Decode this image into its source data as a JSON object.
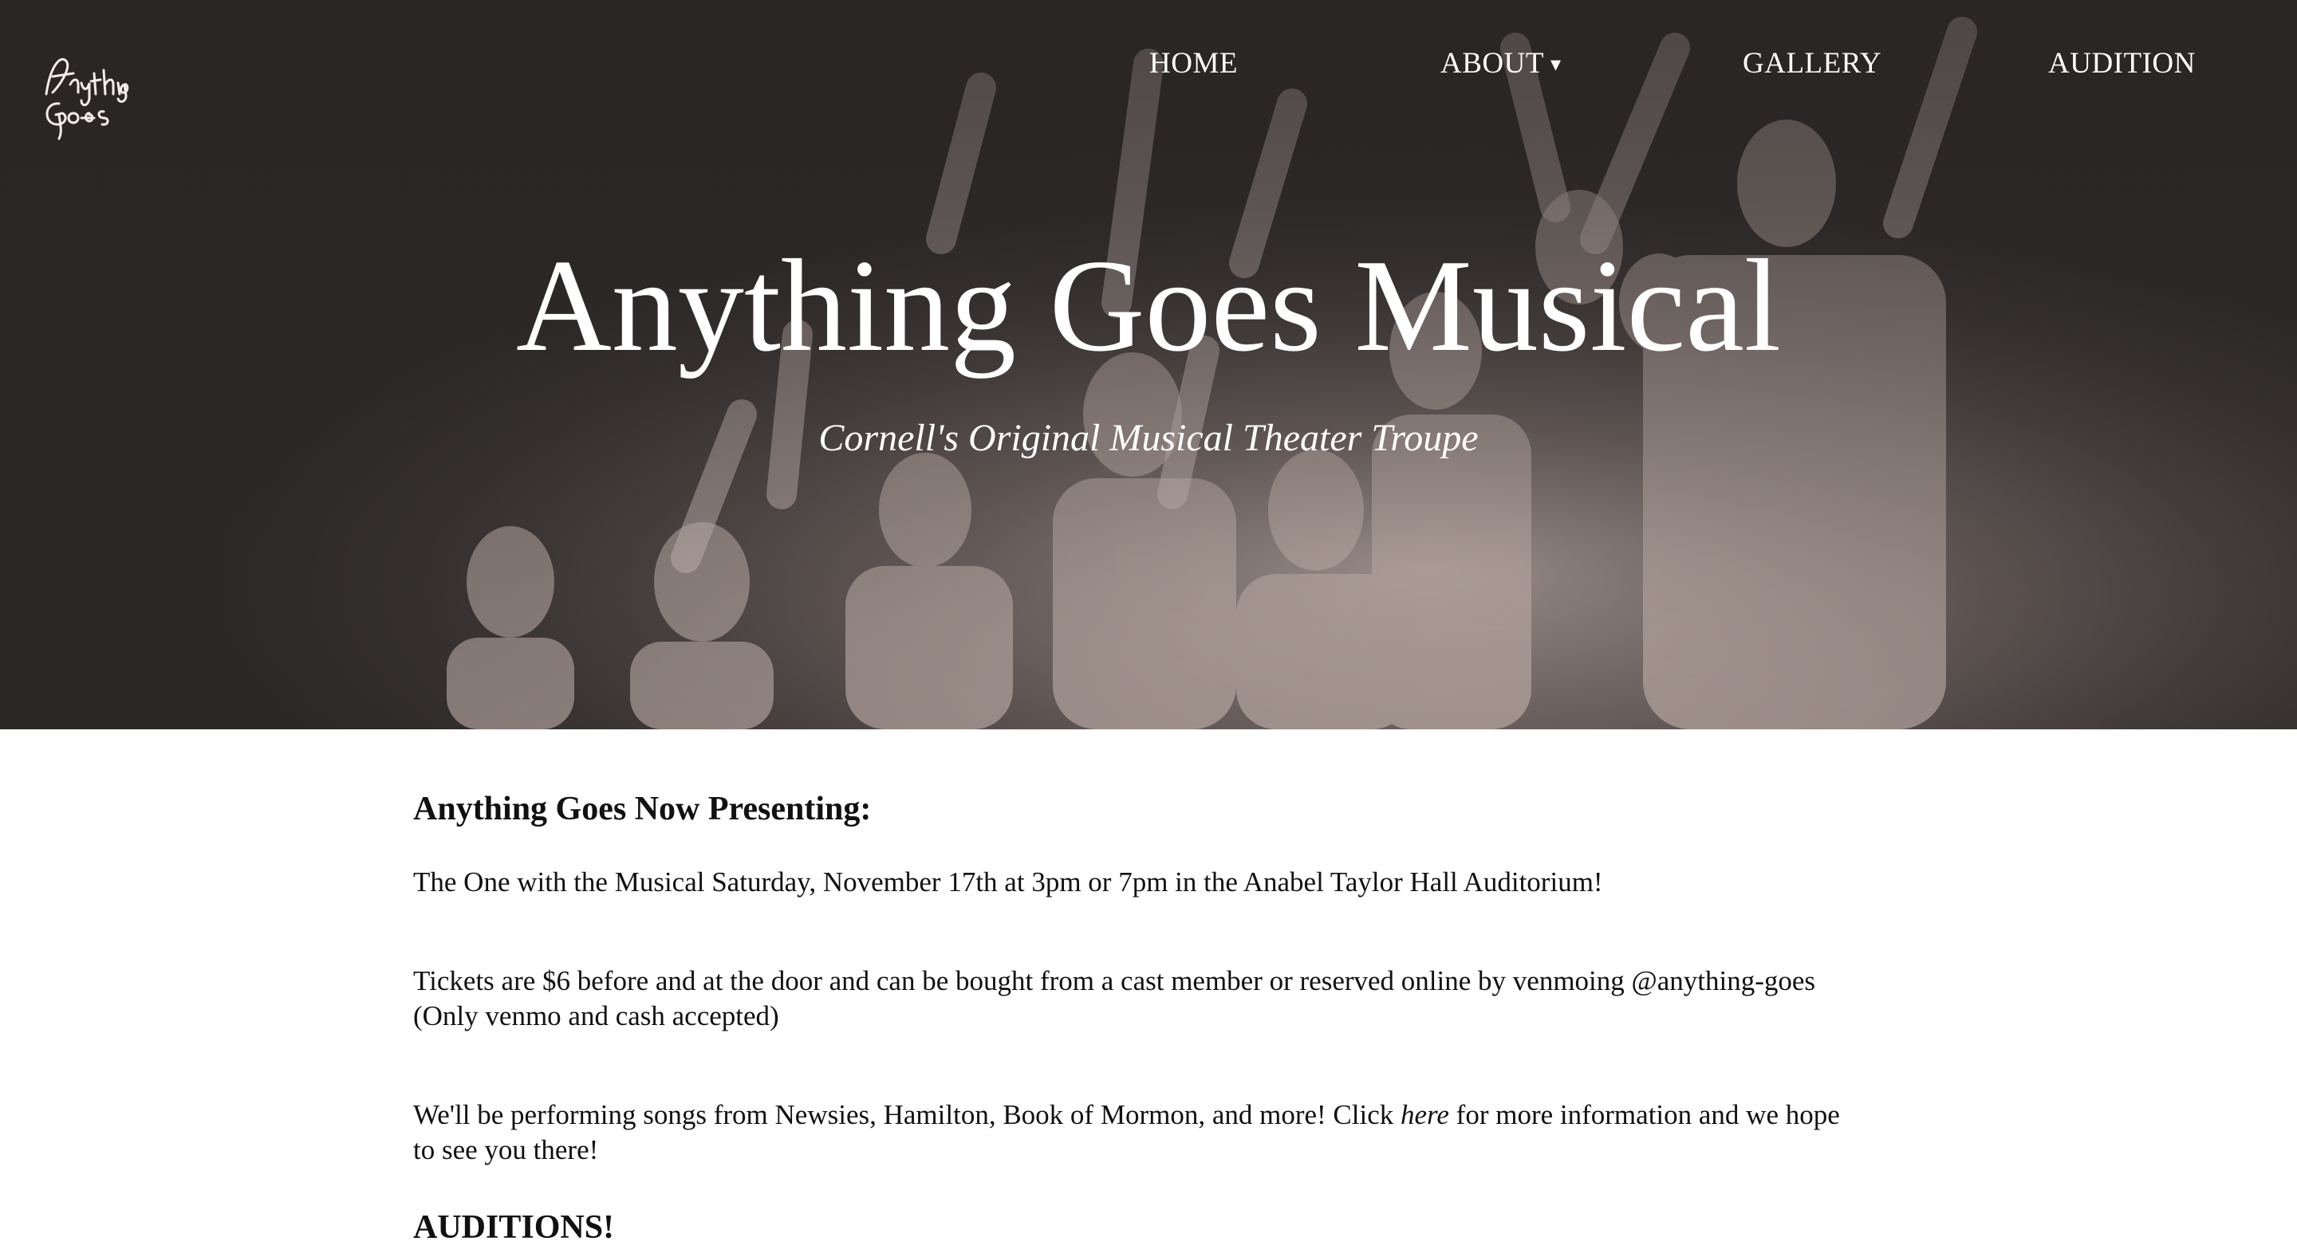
{
  "logo": {
    "text": "Anything Goes",
    "icon": "anything-goes-script-logo"
  },
  "nav": {
    "home": "HOME",
    "about": "ABOUT",
    "about_caret": "▾",
    "gallery": "GALLERY",
    "audition": "AUDITION"
  },
  "hero": {
    "title": "Anything Goes Musical",
    "subtitle": "Cornell's Original Musical Theater Troupe"
  },
  "content": {
    "heading": "Anything Goes Now Presenting:",
    "paragraph1": "The One with the Musical Saturday, November 17th at 3pm or 7pm in the Anabel Taylor Hall Auditorium!",
    "paragraph2_line1": "Tickets are $6 before and at the door and can be bought from a cast member or reserved online by venmoing @anything-goes",
    "paragraph2_line2": "(Only venmo and cash accepted)",
    "paragraph3_before": "We'll be performing songs from Newsies, Hamilton, Book of Mormon, and more! Click ",
    "paragraph3_link": "here",
    "paragraph3_after": " for more information and we hope",
    "paragraph3_line2": "to see you there!",
    "auditions_heading": "AUDITIONS!"
  },
  "colors": {
    "hero_dark": "#2a2626",
    "hero_light": "#d8c7c0",
    "text": "#111111",
    "nav_text": "#ffffff"
  }
}
